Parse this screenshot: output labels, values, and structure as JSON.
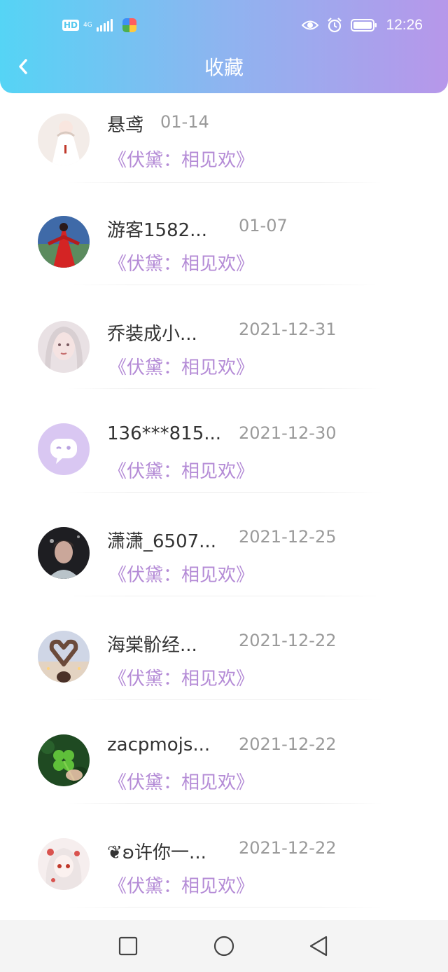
{
  "status_bar": {
    "hd": "HD",
    "network": "4G",
    "time": "12:26",
    "icons": [
      "hd-icon",
      "signal-icon",
      "app-icon",
      "eye-icon",
      "alarm-icon",
      "battery-icon"
    ]
  },
  "header": {
    "title": "收藏",
    "back_icon": "chevron-left-icon",
    "gradient": [
      "#55d4f5",
      "#b797ea"
    ]
  },
  "items": [
    {
      "name": "悬鸢",
      "date": "01-14",
      "book": "《伏黛：相见欢》",
      "avatar": "avatar-girl-white-dress"
    },
    {
      "name": "游客1582...",
      "date": "01-07",
      "book": "《伏黛：相见欢》",
      "avatar": "avatar-red-dress"
    },
    {
      "name": "乔装成小...",
      "date": "2021-12-31",
      "book": "《伏黛：相见欢》",
      "avatar": "avatar-pale-girl"
    },
    {
      "name": "136***815...",
      "date": "2021-12-30",
      "book": "《伏黛：相见欢》",
      "avatar": "avatar-default-chat"
    },
    {
      "name": "潇潇_6507...",
      "date": "2021-12-25",
      "book": "《伏黛：相见欢》",
      "avatar": "avatar-dark-boy"
    },
    {
      "name": "海棠骱经...",
      "date": "2021-12-22",
      "book": "《伏黛：相见欢》",
      "avatar": "avatar-heart-hands"
    },
    {
      "name": "zacpmojs...",
      "date": "2021-12-22",
      "book": "《伏黛：相见欢》",
      "avatar": "avatar-clover"
    },
    {
      "name": "❦ʚ许你一...",
      "date": "2021-12-22",
      "book": "《伏黛：相见欢》",
      "avatar": "avatar-anime-girl"
    }
  ],
  "colors": {
    "book_title": "#b48bd6",
    "date": "#9a9a9a",
    "name": "#333333"
  },
  "nav": [
    "square-icon",
    "circle-icon",
    "triangle-back-icon"
  ]
}
